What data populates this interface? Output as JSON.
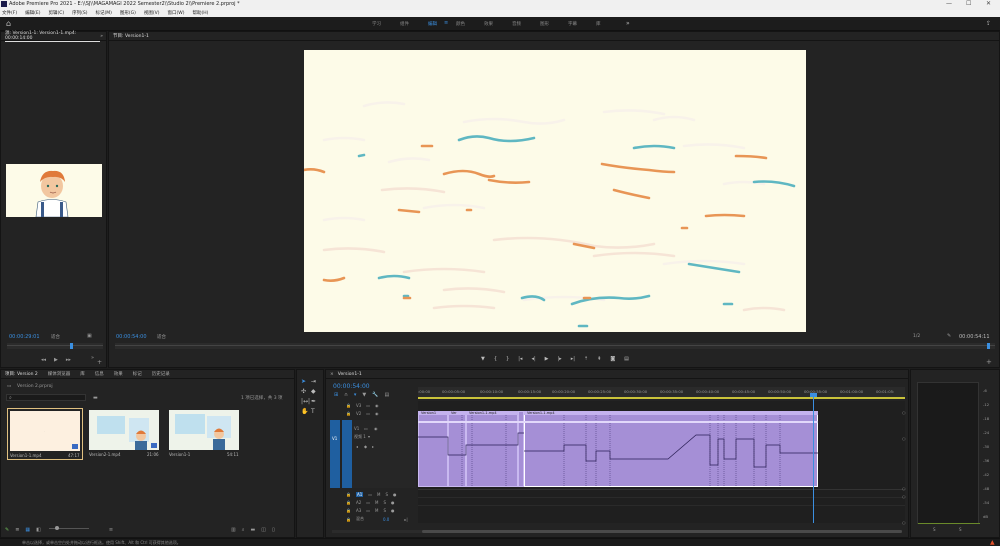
{
  "window": {
    "title": "Adobe Premiere Pro 2021 - E:\\\\SJ\\\\MAGAMAGI 2022 Semester2\\\\Studio 2\\\\Premiere 2.prproj *",
    "min": "—",
    "max": "☐",
    "close": "✕"
  },
  "menu": [
    "文件(F)",
    "编辑(E)",
    "剪辑(C)",
    "序列(S)",
    "标记(M)",
    "图形(G)",
    "视图(V)",
    "窗口(W)",
    "帮助(H)"
  ],
  "workspaces": [
    "学习",
    "组件",
    "编辑",
    "颜色",
    "效果",
    "音频",
    "图形",
    "字幕",
    "库"
  ],
  "source_monitor": {
    "tab": "源: Version1-1: Version1-1.mp4: 00:00:14:00",
    "tab2": "节目: Version1-1",
    "timecode": "00:00:29:01",
    "fit": "适合"
  },
  "program_monitor": {
    "tab": "节目: Version1-1",
    "timecode": "00:00:54:00",
    "fit": "适合",
    "scale": "1/2",
    "duration": "00:00:54:11"
  },
  "project": {
    "tabs": [
      "项目: Version 2",
      "媒体浏览器",
      "库",
      "信息",
      "效果",
      "标记",
      "历史记录"
    ],
    "file": "Version 2.prproj",
    "selection": "1 项已选择，共 3 项",
    "search_placeholder": "",
    "items": [
      {
        "name": "Version1-1.mp4",
        "duration": "47:17"
      },
      {
        "name": "Version2-1.mp4",
        "duration": "21:06"
      },
      {
        "name": "Version1-1",
        "duration": "54:11"
      }
    ]
  },
  "timeline": {
    "tab": "Version1-1",
    "timecode": "00:00:54:00",
    "ruler": [
      ":00:00",
      "00:00:05:00",
      "00:00:10:00",
      "00:00:15:00",
      "00:00:20:00",
      "00:00:25:00",
      "00:00:30:00",
      "00:00:35:00",
      "00:00:40:00",
      "00:00:45:00",
      "00:00:50:00",
      "00:00:55:00",
      "00:01:00:00",
      "00:01:05:"
    ],
    "video_tracks": [
      "V3",
      "V2",
      "V1"
    ],
    "audio_tracks": [
      "A1",
      "A2",
      "A3"
    ],
    "master": "混合",
    "master_value": "0.0",
    "clips": [
      "Version1",
      "Ver",
      "Version1-1.mp4",
      "Version1-1.mp4"
    ],
    "track_label": "视频 1"
  },
  "meter": {
    "scale": [
      "-6",
      "-12",
      "-18",
      "-24",
      "-30",
      "-36",
      "-42",
      "-48",
      "-54",
      "dB"
    ],
    "labels": [
      "S",
      "S"
    ]
  },
  "status": {
    "text": "单击以选择，或单击空白处并拖动以进行框选。使用 Shift、Alt 和 Ctrl 可获得其他选项。"
  },
  "colors": {
    "accent": "#3b8fe0",
    "clip": "#a58fd6",
    "canvas": "#fdfbe8"
  }
}
